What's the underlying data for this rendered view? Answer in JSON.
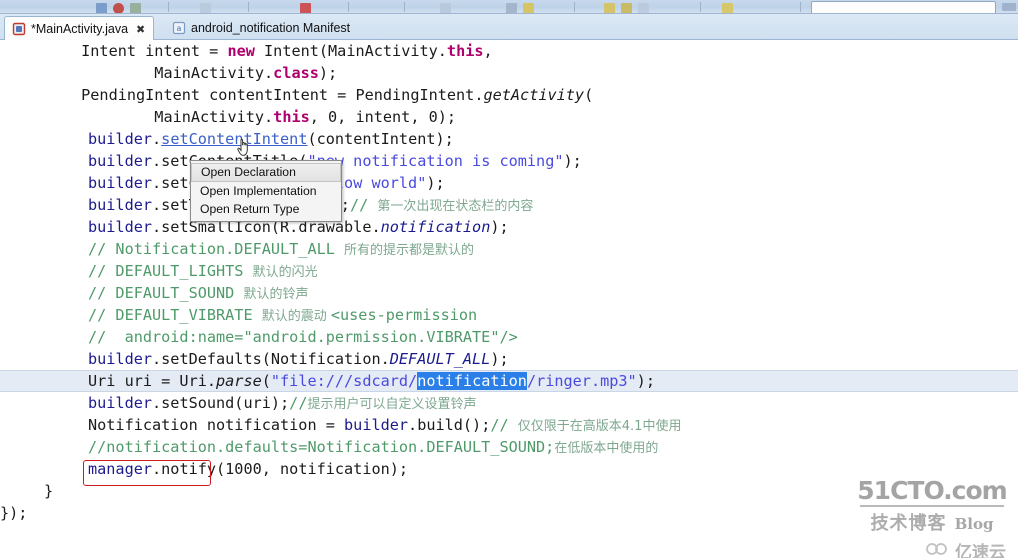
{
  "window": {
    "app": "Eclipse IDE",
    "toolbar": {
      "icons": [
        "save-icon",
        "debug-icon",
        "run-icon",
        "new-icon",
        "external-tools-icon",
        "search-icon",
        "next-annotation-icon",
        "previous-annotation-icon",
        "back-icon",
        "forward-icon"
      ],
      "search_placeholder": ""
    }
  },
  "tabs": [
    {
      "label": "*MainActivity.java",
      "icon": "java-file-icon",
      "close": "✖",
      "active": true
    },
    {
      "label": "android_notification Manifest",
      "icon": "xml-file-icon",
      "close": "",
      "active": false
    }
  ],
  "context_menu": {
    "items": [
      {
        "label": "Open Declaration",
        "hovered": true
      },
      {
        "label": "Open Implementation",
        "hovered": false
      },
      {
        "label": "Open Return Type",
        "hovered": false
      }
    ]
  },
  "editor": {
    "selection": "notification",
    "cursor": "hand-pointer-cursor",
    "annotation_color": "#d0191f",
    "current_line_color": "#e4ebf5",
    "selection_color": "#2b7fe8",
    "lines": [
      {
        "id": 1,
        "text": "        Intent intent = new Intent(MainActivity.this,"
      },
      {
        "id": 2,
        "text": "                MainActivity.class);"
      },
      {
        "id": 3,
        "text": "        PendingIntent contentIntent = PendingIntent.getActivity("
      },
      {
        "id": 4,
        "text": "                MainActivity.this, 0, intent, 0);"
      },
      {
        "id": 5,
        "text": "        builder.setContentIntent(contentIntent);"
      },
      {
        "id": 6,
        "text": "        builder.setContentTitle(\"new notification is coming\");"
      },
      {
        "id": 7,
        "text": "        builder.setContentText(\"hellow world\");"
      },
      {
        "id": 8,
        "text": "        builder.setTicker(\"通知来了\");// 第一次出现在状态栏的内容"
      },
      {
        "id": 9,
        "text": "        builder.setSmallIcon(R.drawable.notification);"
      },
      {
        "id": 10,
        "text": "        // Notification.DEFAULT_ALL 所有的提示都是默认的"
      },
      {
        "id": 11,
        "text": "        // DEFAULT_LIGHTS 默认的闪光"
      },
      {
        "id": 12,
        "text": "        // DEFAULT_SOUND 默认的铃声"
      },
      {
        "id": 13,
        "text": "        // DEFAULT_VIBRATE 默认的震动 <uses-permission"
      },
      {
        "id": 14,
        "text": "        // android:name=\"android.permission.VIBRATE\"/>"
      },
      {
        "id": 15,
        "text": "        builder.setDefaults(Notification.DEFAULT_ALL);"
      },
      {
        "id": 16,
        "text": "        Uri uri = Uri.parse(\"file:///sdcard/notification/ringer.mp3\");",
        "current": true
      },
      {
        "id": 17,
        "text": "        builder.setSound(uri);//提示用户可以自定义设置铃声"
      },
      {
        "id": 18,
        "text": "        Notification notification = builder.build();// 仅仅限于在高版本4.1中使用"
      },
      {
        "id": 19,
        "text": "        //notification.defaults=Notification.DEFAULT_SOUND;在低版本中使用的"
      },
      {
        "id": 20,
        "text": "        manager.notify(1000, notification);"
      },
      {
        "id": 21,
        "text": "    }"
      },
      {
        "id": 22,
        "text": "});"
      }
    ]
  },
  "watermark": {
    "site": "51CTO.com",
    "cn": "技术博客",
    "blog": "Blog",
    "partner": "亿速云"
  }
}
